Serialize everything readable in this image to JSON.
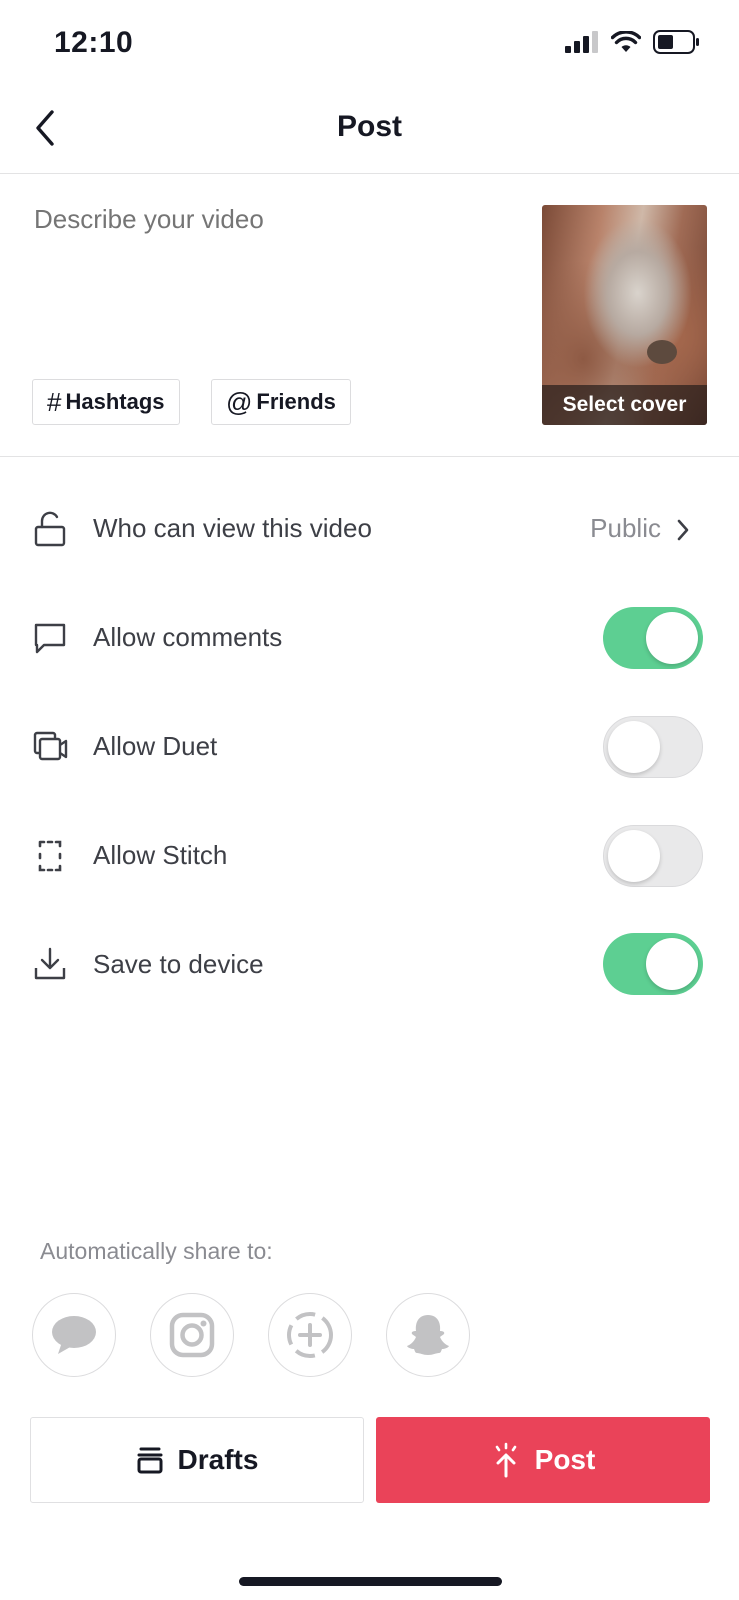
{
  "status_bar": {
    "time": "12:10",
    "signal_icon": "signal-bars-icon",
    "wifi_icon": "wifi-icon",
    "battery_icon": "battery-icon"
  },
  "header": {
    "title": "Post",
    "back_icon": "chevron-left-icon"
  },
  "description": {
    "placeholder": "Describe your video",
    "value": ""
  },
  "chips": [
    {
      "symbol": "#",
      "label": "Hashtags"
    },
    {
      "symbol": "@",
      "label": "Friends"
    }
  ],
  "cover": {
    "label": "Select cover"
  },
  "settings": {
    "visibility": {
      "label": "Who can view this video",
      "value": "Public",
      "icon": "lock-open-icon"
    },
    "comments": {
      "label": "Allow comments",
      "icon": "comment-icon",
      "enabled": true
    },
    "duet": {
      "label": "Allow Duet",
      "icon": "duet-icon",
      "enabled": false
    },
    "stitch": {
      "label": "Allow Stitch",
      "icon": "stitch-icon",
      "enabled": false
    },
    "save": {
      "label": "Save to device",
      "icon": "download-icon",
      "enabled": true
    }
  },
  "share": {
    "label": "Automatically share to:",
    "targets": [
      "message-icon",
      "instagram-icon",
      "add-story-icon",
      "snapchat-icon"
    ]
  },
  "actions": {
    "drafts_label": "Drafts",
    "post_label": "Post"
  },
  "colors": {
    "toggle_on": "#5dcf92",
    "toggle_off": "#e9e9ea",
    "post_button": "#ea4359",
    "text_primary": "#161823",
    "text_secondary": "#8a8b91"
  }
}
